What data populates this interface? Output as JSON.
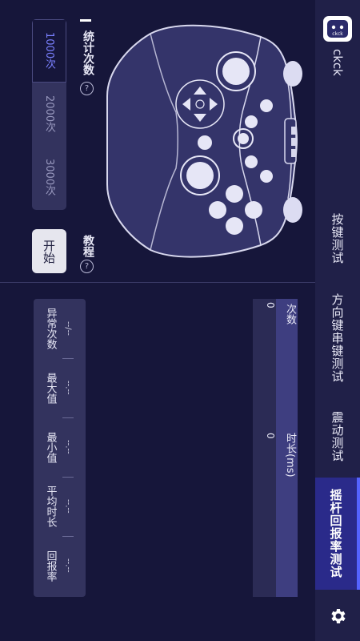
{
  "app": {
    "name": "ckck",
    "logo_text": "ckck"
  },
  "nav": {
    "items": [
      {
        "label": "按键测试",
        "active": false
      },
      {
        "label": "方向键串键测试",
        "active": false
      },
      {
        "label": "震动测试",
        "active": false
      },
      {
        "label": "摇杆回报率测试",
        "active": true
      }
    ],
    "settings_icon": "gear-icon"
  },
  "controls": {
    "count_title": "统计次数",
    "count_options": [
      "1000次",
      "2000次",
      "3000次"
    ],
    "selected_count": "1000次",
    "tutorial_label": "教程",
    "start_label": "开始",
    "help_icon": "?"
  },
  "results": {
    "headers": [
      "次数",
      "时长(ms)"
    ],
    "values": [
      "0",
      "0"
    ]
  },
  "stats": [
    {
      "label": "异常次数",
      "value": "--/--"
    },
    {
      "label": "最大值",
      "value": "--.--"
    },
    {
      "label": "最小值",
      "value": "--.--"
    },
    {
      "label": "平均时长",
      "value": "--.--"
    },
    {
      "label": "回报率",
      "value": "--.--"
    }
  ],
  "colors": {
    "background": "#16163a",
    "nav": "#202048",
    "accent": "#5563ff",
    "active_tab": "#2a2a8a"
  }
}
